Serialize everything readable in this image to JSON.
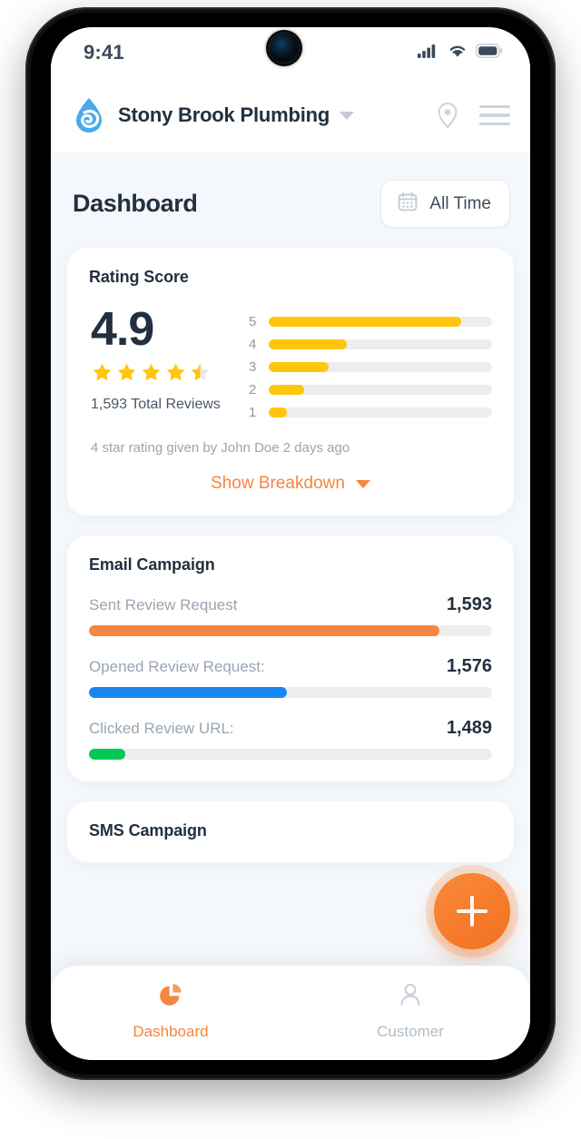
{
  "device": {
    "camera_icon": "front-camera",
    "status_bar": {
      "time": "9:41",
      "signal_icon": "cellular-signal-icon",
      "wifi_icon": "wifi-icon",
      "battery_icon": "battery-full-icon"
    }
  },
  "header": {
    "logo_icon": "water-drop-logo",
    "brand": "Stony Brook Plumbing",
    "brand_caret_icon": "chevron-down-icon",
    "location_icon": "location-pin-icon",
    "menu_icon": "hamburger-menu-icon"
  },
  "page": {
    "title": "Dashboard",
    "date_filter": {
      "label": "All Time",
      "icon": "calendar-icon"
    }
  },
  "rating_card": {
    "title": "Rating Score",
    "score": "4.9",
    "stars_filled": 4.5,
    "total_reviews": "1,593 Total Reviews",
    "note": "4 star rating given by John Doe 2 days ago",
    "breakdown_label": "Show Breakdown",
    "breakdown_caret_icon": "chevron-down-icon",
    "histogram": [
      {
        "label": "5",
        "percent": 86
      },
      {
        "label": "4",
        "percent": 35
      },
      {
        "label": "3",
        "percent": 27
      },
      {
        "label": "2",
        "percent": 16
      },
      {
        "label": "1",
        "percent": 8
      }
    ]
  },
  "email_card": {
    "title": "Email Campaign",
    "metrics": [
      {
        "label": "Sent Review Request",
        "value": "1,593",
        "percent": 87,
        "color": "#f5853f"
      },
      {
        "label": "Opened Review Request:",
        "value": "1,576",
        "percent": 49,
        "color": "#1787f0"
      },
      {
        "label": "Clicked Review URL:",
        "value": "1,489",
        "percent": 9,
        "color": "#00c853"
      }
    ]
  },
  "sms_card": {
    "title": "SMS Campaign"
  },
  "fab": {
    "icon": "plus-icon",
    "label": "+"
  },
  "bottom_nav": {
    "items": [
      {
        "label": "Dashboard",
        "icon": "pie-chart-icon",
        "active": true
      },
      {
        "label": "Customer",
        "icon": "person-icon",
        "active": false
      }
    ]
  },
  "colors": {
    "accent": "#f5853f",
    "star": "#ffc60b",
    "blue": "#1787f0",
    "green": "#00c853",
    "background": "#f4f7fb",
    "text_dark": "#22303f",
    "text_muted": "#9aa5b1"
  }
}
